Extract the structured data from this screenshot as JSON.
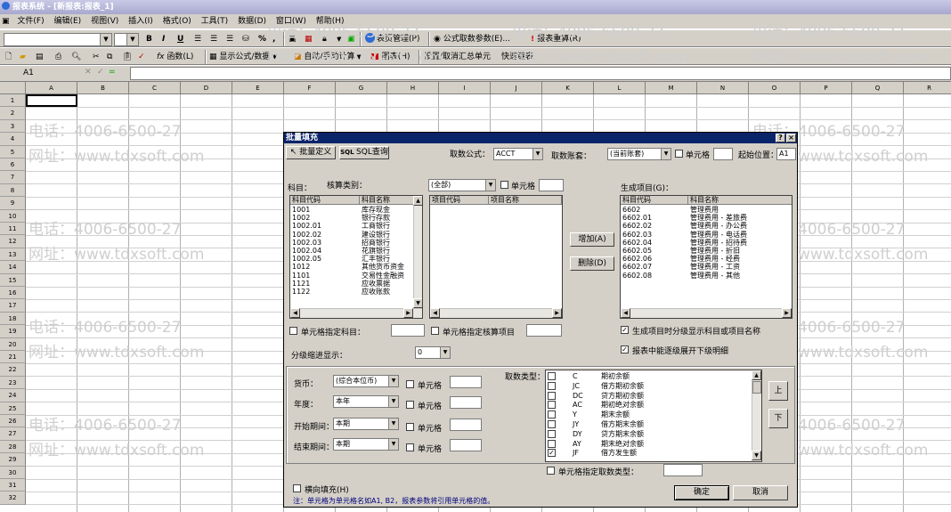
{
  "window": {
    "title": "报表系统 - [新报表:报表_1]"
  },
  "menu": [
    "文件(F)",
    "编辑(E)",
    "视图(V)",
    "插入(I)",
    "格式(O)",
    "工具(T)",
    "数据(D)",
    "窗口(W)",
    "帮助(H)"
  ],
  "toolbar1": {
    "bold": "B",
    "italic": "I",
    "underline": "U",
    "percent": "%",
    "comma": ",",
    "table_mgmt": "表页管理(P)",
    "formula_param": "公式取数参数(E)...",
    "recalc": "报表重算(R)"
  },
  "toolbar2": {
    "func": "函数(L)",
    "show_formula": "显示公式/数据",
    "auto_calc": "自动/手动计算",
    "chart": "图表(H)",
    "set_summary": "设置/取消汇总单元",
    "quick_link": "快速链表"
  },
  "formula_bar": {
    "cell_ref": "A1"
  },
  "columns": [
    "A",
    "B",
    "C",
    "D",
    "E",
    "F",
    "G",
    "H",
    "I",
    "J",
    "K",
    "L",
    "M",
    "N",
    "O",
    "P",
    "Q",
    "R"
  ],
  "rows": [
    "1",
    "2",
    "3",
    "4",
    "5",
    "6",
    "7",
    "8",
    "9",
    "10",
    "11",
    "12",
    "13",
    "14",
    "15",
    "16",
    "17",
    "18",
    "19",
    "20",
    "21",
    "22",
    "23",
    "24",
    "25",
    "26",
    "27",
    "28",
    "29",
    "30",
    "31",
    "32"
  ],
  "watermark": {
    "phone": "电话：4006-6500-27",
    "site": "网址：www.tdxsoft.com"
  },
  "dialog": {
    "title": "批量填充",
    "help_btn": "?",
    "close_btn": "×",
    "tab_batch": "批量定义",
    "tab_sql": "SQL查询",
    "fetch_formula_label": "取数公式：",
    "fetch_formula_value": "ACCT",
    "fetch_book_label": "取数账套：",
    "fetch_book_value": "(当前账套)",
    "unit_cell_label": "单元格",
    "start_pos_label": "起始位置：",
    "start_pos_value": "A1",
    "subject_label": "科目：",
    "calc_type_label": "核算类别：",
    "calc_type_value": "(全部)",
    "calc_unit_label": "单元格",
    "subject_list": {
      "headers": [
        "科目代码",
        "科目名称"
      ],
      "rows": [
        [
          "1001",
          "库存现金"
        ],
        [
          "1002",
          "银行存款"
        ],
        [
          "1002.01",
          "工商银行"
        ],
        [
          "1002.02",
          "建设银行"
        ],
        [
          "1002.03",
          "招商银行"
        ],
        [
          "1002.04",
          "花旗银行"
        ],
        [
          "1002.05",
          "汇丰银行"
        ],
        [
          "1012",
          "其他货币资金"
        ],
        [
          "1101",
          "交易性金融资"
        ],
        [
          "1121",
          "应收票据"
        ],
        [
          "1122",
          "应收账款"
        ]
      ]
    },
    "project_list": {
      "headers": [
        "项目代码",
        "项目名称"
      ]
    },
    "gen_label": "生成项目(G)：",
    "gen_list": {
      "headers": [
        "科目代码",
        "科目名称"
      ],
      "rows": [
        [
          "6602",
          "管理费用"
        ],
        [
          "6602.01",
          "管理费用 - 差旅费"
        ],
        [
          "6602.02",
          "管理费用 - 办公费"
        ],
        [
          "6602.03",
          "管理费用 - 电话费"
        ],
        [
          "6602.04",
          "管理费用 - 招待费"
        ],
        [
          "6602.05",
          "管理费用 - 折旧"
        ],
        [
          "6602.06",
          "管理费用 - 经费"
        ],
        [
          "6602.07",
          "管理费用 - 工资"
        ],
        [
          "6602.08",
          "管理费用 - 其他"
        ]
      ]
    },
    "add_btn": "增加(A)",
    "del_btn": "删除(D)",
    "cell_subject_label": "单元格指定科目：",
    "cell_project_label": "单元格指定核算项目",
    "gen_check1": "生成项目时分级显示科目或项目名称",
    "gen_check2": "报表中能逐级展开下级明细",
    "level_label": "分级缩进显示：",
    "level_value": "0",
    "currency_label": "货币：",
    "currency_value": "(综合本位币)",
    "year_label": "年度：",
    "year_value": "本年",
    "start_period_label": "开始期间：",
    "start_period_value": "本期",
    "end_period_label": "结束期间：",
    "end_period_value": "本期",
    "cell_label": "单元格",
    "fetch_type_label": "取数类型：",
    "fetch_types": [
      [
        "C",
        "期初余额",
        false
      ],
      [
        "JC",
        "借方期初余额",
        false
      ],
      [
        "DC",
        "贷方期初余额",
        false
      ],
      [
        "AC",
        "期初绝对余额",
        false
      ],
      [
        "Y",
        "期末余额",
        false
      ],
      [
        "JY",
        "借方期末余额",
        false
      ],
      [
        "DY",
        "贷方期末余额",
        false
      ],
      [
        "AY",
        "期末绝对余额",
        false
      ],
      [
        "JF",
        "借方发生额",
        true
      ]
    ],
    "up_btn": "上",
    "down_btn": "下",
    "cell_fetch_type_label": "单元格指定取数类型：",
    "transpose_label": "横向填充(H)",
    "hint": "注：单元格为单元格名如A1, B2，报表参数将引用单元格的值。",
    "ok_btn": "确定",
    "cancel_btn": "取消"
  }
}
